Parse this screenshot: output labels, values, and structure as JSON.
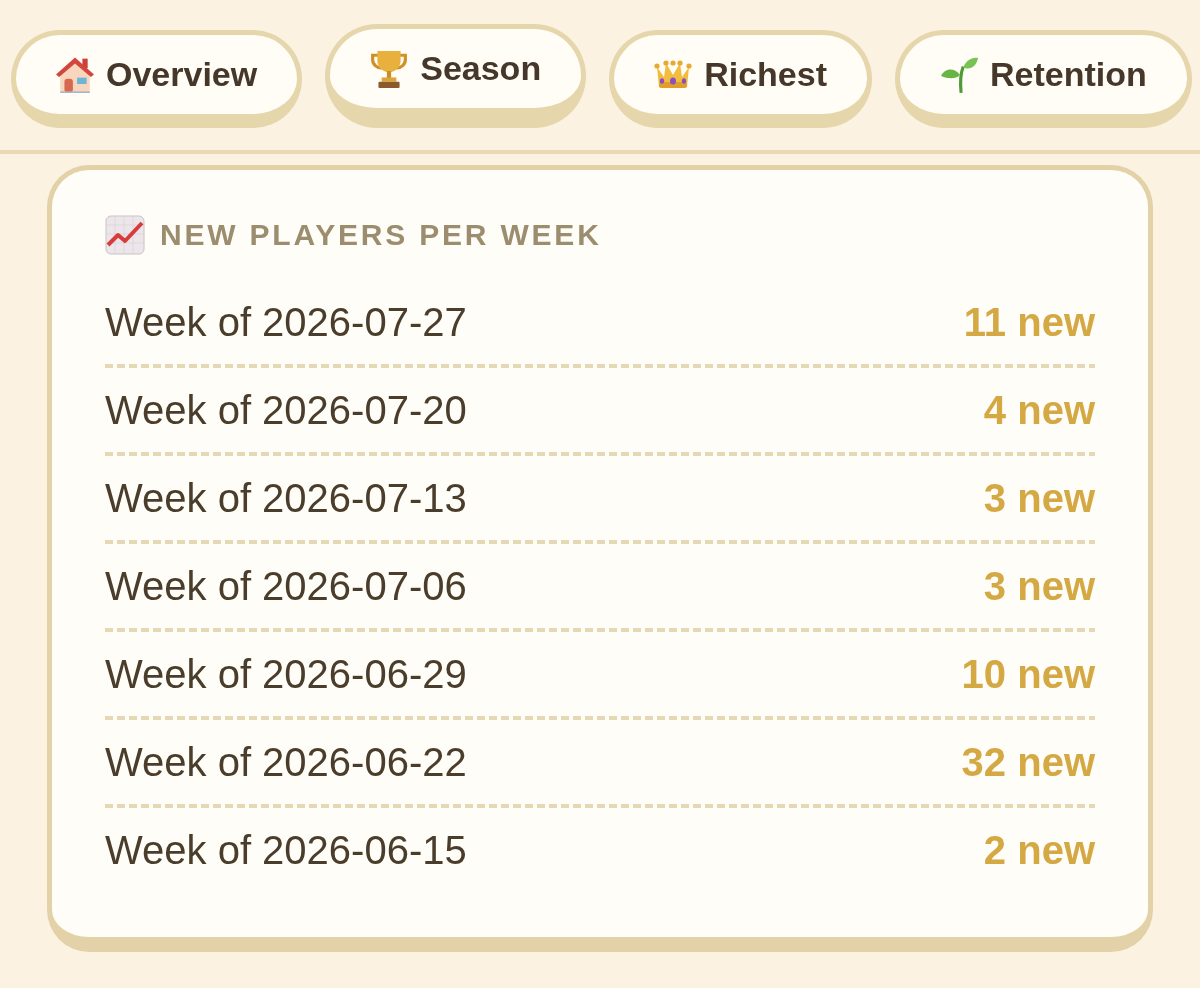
{
  "tabs": [
    {
      "label": "Overview",
      "selected": false
    },
    {
      "label": "Season",
      "selected": true
    },
    {
      "label": "Richest",
      "selected": false
    },
    {
      "label": "Retention",
      "selected": false
    }
  ],
  "panel": {
    "title": "NEW PLAYERS PER WEEK",
    "rows": [
      {
        "label": "Week of 2026-07-27",
        "value": "11 new"
      },
      {
        "label": "Week of 2026-07-20",
        "value": "4 new"
      },
      {
        "label": "Week of 2026-07-13",
        "value": "3 new"
      },
      {
        "label": "Week of 2026-07-06",
        "value": "3 new"
      },
      {
        "label": "Week of 2026-06-29",
        "value": "10 new"
      },
      {
        "label": "Week of 2026-06-22",
        "value": "32 new"
      },
      {
        "label": "Week of 2026-06-15",
        "value": "2 new"
      }
    ]
  }
}
